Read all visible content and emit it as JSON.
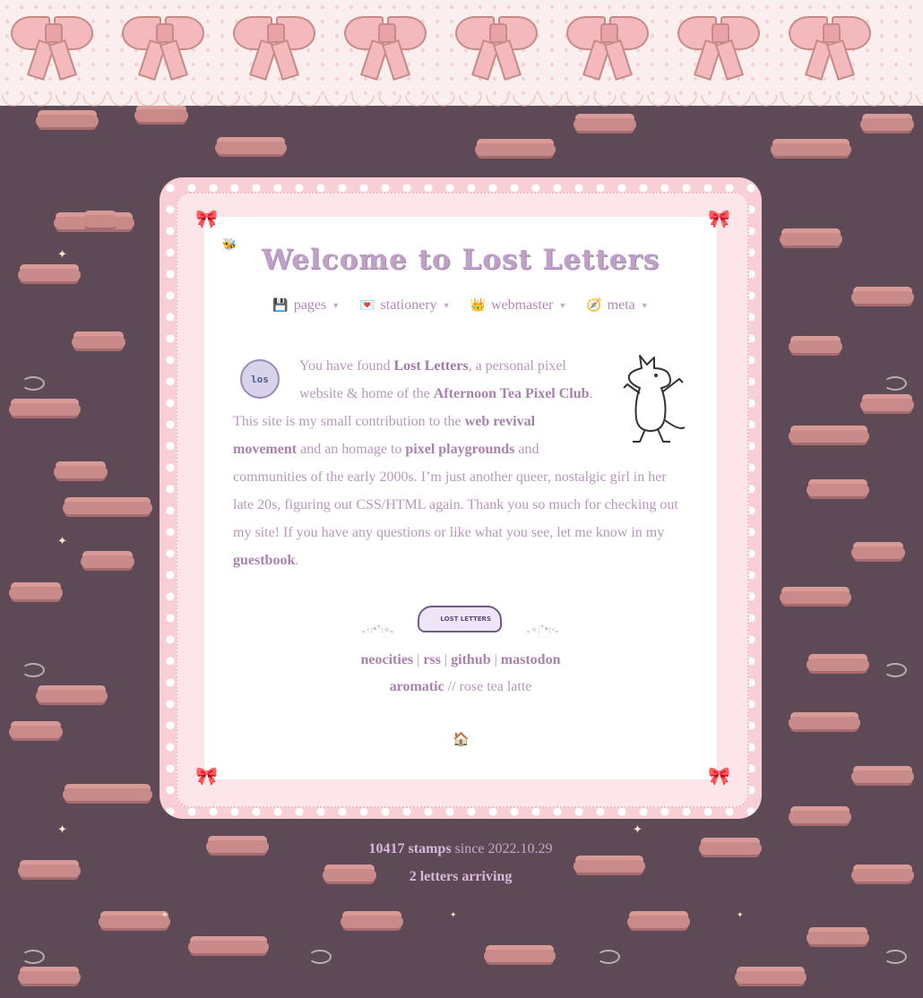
{
  "title": "Welcome to Lost Letters",
  "nav": [
    {
      "icon": "💾",
      "label": "pages"
    },
    {
      "icon": "💌",
      "label": "stationery"
    },
    {
      "icon": "👑",
      "label": "webmaster"
    },
    {
      "icon": "🧭",
      "label": "meta"
    }
  ],
  "intro": {
    "avatar_text": "los",
    "p1": "You have found ",
    "site_name": "Lost Letters",
    "p2": ", a personal pixel website & home of the ",
    "club": "Afternoon Tea Pixel Club",
    "p3": ". This site is my small contribution to the ",
    "web_revival": "web revival movement",
    "p4": " and an homage to ",
    "pixel_playgrounds": "pixel playgrounds",
    "p5": " and communities of the early 2000s. I’m just another queer, nostalgic girl in her late 20s, figuring out CSS/HTML again. Thank you so much for checking out my site! If you have any questions or like what you see, let me know in my ",
    "guestbook": "guestbook",
    "p6": "."
  },
  "signature": {
    "badge_text": "LOST LETTERS",
    "dots_left": "｡･:*˚:✧｡",
    "dots_right": "｡✧:˚*:･｡"
  },
  "links": {
    "neocities": "neocities",
    "rss": "rss",
    "github": "github",
    "mastodon": "mastodon",
    "sep": "|",
    "aromatic": "aromatic",
    "scent": "// rose tea latte"
  },
  "home_icon": "🏠",
  "footer": {
    "stamps": "10417 stamps",
    "since": "since 2022.10.29",
    "letters": "2 letters arriving"
  },
  "colors": {
    "background": "#5e4a56",
    "cloud": "#c98b8a",
    "accent": "#a881ad",
    "lace": "#f9cfd6"
  }
}
